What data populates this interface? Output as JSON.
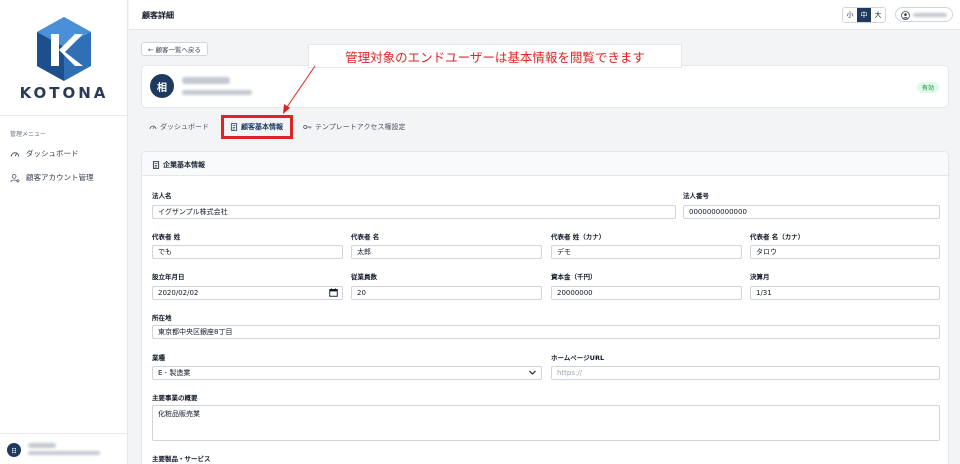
{
  "brand": {
    "name": "KOTONA"
  },
  "sidebar": {
    "menu_label": "管理メニュー",
    "items": [
      {
        "label": "ダッシュボード",
        "icon": "gauge-icon"
      },
      {
        "label": "顧客アカウント管理",
        "icon": "user-gear-icon"
      }
    ],
    "footer_avatar_initial": "日"
  },
  "header": {
    "title": "顧客詳細",
    "font_sizes": [
      "小",
      "中",
      "大"
    ],
    "active_font_size": "中"
  },
  "back_button": "← 顧客一覧へ戻る",
  "callout": "管理対象のエンドユーザーは基本情報を閲覧できます",
  "profile": {
    "avatar_initial": "相",
    "status": "有効"
  },
  "tabs": [
    {
      "label": "ダッシュボード",
      "icon": "gauge-icon"
    },
    {
      "label": "顧客基本情報",
      "icon": "document-icon",
      "active": true
    },
    {
      "label": "テンプレートアクセス権設定",
      "icon": "key-icon"
    }
  ],
  "form": {
    "title": "企業基本情報",
    "fields": {
      "corp_name": {
        "label": "法人名",
        "value": "イグザンプル株式会社"
      },
      "corp_number": {
        "label": "法人番号",
        "value": "0000000000000"
      },
      "rep_last": {
        "label": "代表者 姓",
        "value": "でも"
      },
      "rep_first": {
        "label": "代表者 名",
        "value": "太郎"
      },
      "rep_last_kana": {
        "label": "代表者 姓（カナ）",
        "value": "デモ"
      },
      "rep_first_kana": {
        "label": "代表者 名（カナ）",
        "value": "タロウ"
      },
      "founded": {
        "label": "設立年月日",
        "value": "2020/02/02"
      },
      "employees": {
        "label": "従業員数",
        "value": "20"
      },
      "capital": {
        "label": "資本金（千円）",
        "value": "20000000"
      },
      "fiscal_month": {
        "label": "決算月",
        "value": "1/31"
      },
      "address": {
        "label": "所在地",
        "value": "東京都中央区銀座8丁目"
      },
      "industry": {
        "label": "業種",
        "value": "E - 製造業"
      },
      "homepage": {
        "label": "ホームページURL",
        "placeholder": "https://"
      },
      "business_summary": {
        "label": "主要事業の概要",
        "value": "化粧品販売業"
      },
      "products": {
        "label": "主要製品・サービス"
      }
    }
  },
  "colors": {
    "accent": "#1e3a5f",
    "highlight": "#e02424",
    "success_bg": "#dcfce7",
    "success_text": "#15803d"
  }
}
